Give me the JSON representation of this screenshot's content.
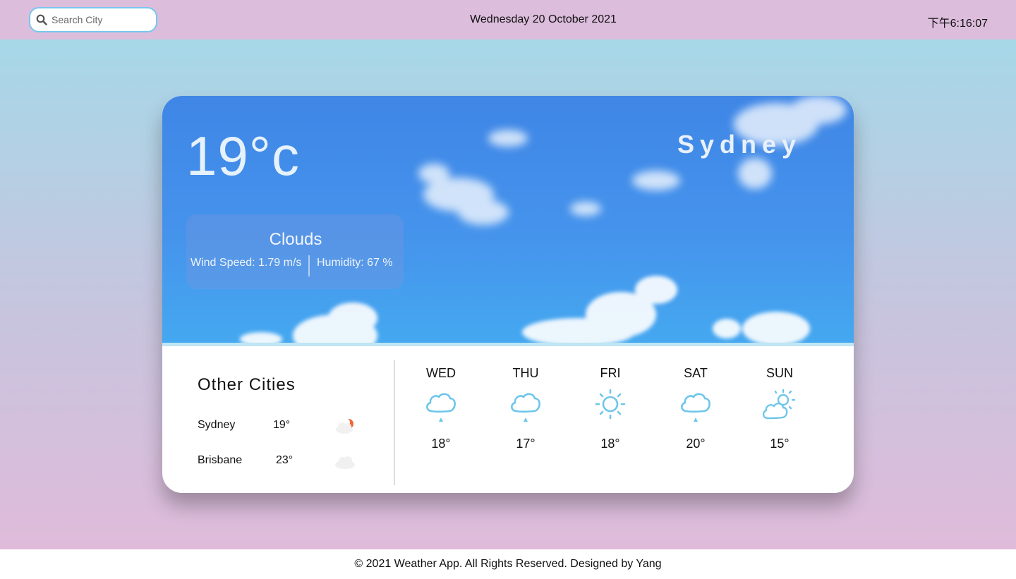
{
  "header": {
    "search_placeholder": "Search City",
    "date": "Wednesday 20 October 2021",
    "time": "下午6:16:07"
  },
  "current": {
    "temperature": "19°c",
    "city": "Sydney",
    "condition": "Clouds",
    "wind_speed": "Wind Speed: 1.79 m/s",
    "humidity": "Humidity: 67 %"
  },
  "other_cities": {
    "title": "Other Cities",
    "items": [
      {
        "name": "Sydney",
        "temp": "19°",
        "icon": "partly-cloudy-night-icon"
      },
      {
        "name": "Brisbane",
        "temp": "23°",
        "icon": "cloud-icon"
      }
    ]
  },
  "forecast": [
    {
      "day": "WED",
      "temp": "18°",
      "icon": "rain-cloud-icon"
    },
    {
      "day": "THU",
      "temp": "17°",
      "icon": "rain-cloud-icon"
    },
    {
      "day": "FRI",
      "temp": "18°",
      "icon": "sun-icon"
    },
    {
      "day": "SAT",
      "temp": "20°",
      "icon": "rain-cloud-icon"
    },
    {
      "day": "SUN",
      "temp": "15°",
      "icon": "sun-cloud-icon"
    }
  ],
  "footer": {
    "text": "© 2021 Weather App. All Rights Reserved. Designed by Yang"
  },
  "colors": {
    "topbar": "#dcbddc",
    "search_border": "#77c7ee",
    "sky": "#4593ec",
    "icon_blue": "#6ec6ea",
    "sunset_orange": "#f0653a"
  }
}
